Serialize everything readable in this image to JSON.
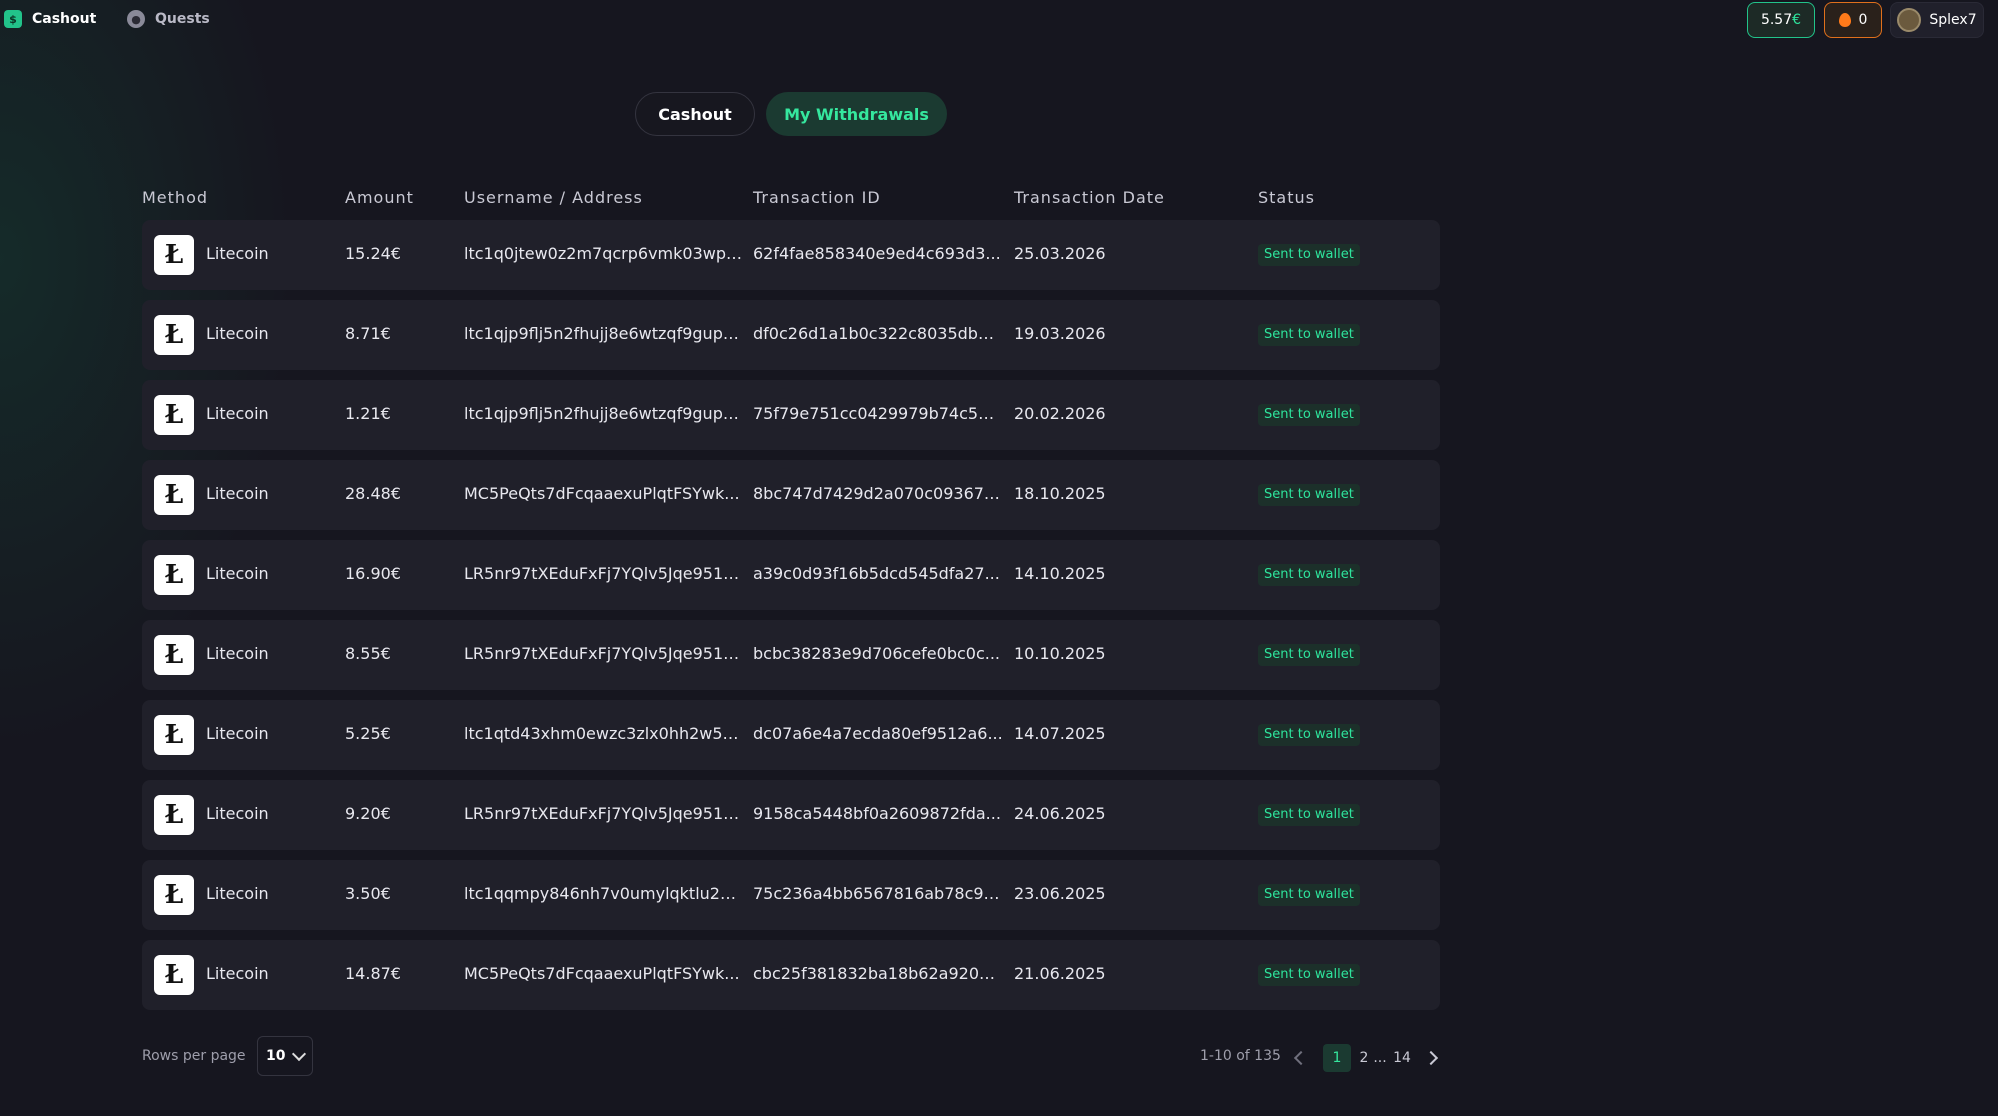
{
  "nav": {
    "items": [
      {
        "label": "Cashout",
        "icon": "dollar-icon"
      },
      {
        "label": "Quests",
        "icon": "medal-icon"
      }
    ],
    "balance": {
      "amount": "5.57",
      "currency": "€"
    },
    "streak": "0",
    "username": "Splex7"
  },
  "tabs": [
    {
      "label": "Cashout",
      "active": false
    },
    {
      "label": "My Withdrawals",
      "active": true
    }
  ],
  "table": {
    "columns": [
      "Method",
      "Amount",
      "Username / Address",
      "Transaction ID",
      "Transaction Date",
      "Status"
    ],
    "rows": [
      {
        "method": "Litecoin",
        "amount": "15.24€",
        "address": "ltc1q0jtew0z2m7qcrp6vmk03wp2...",
        "tx": "62f4fae858340e9ed4c693d3...",
        "date": "25.03.2026",
        "status": "Sent to wallet"
      },
      {
        "method": "Litecoin",
        "amount": "8.71€",
        "address": "ltc1qjp9flj5n2fhujj8e6wtzqf9gup4...",
        "tx": "df0c26d1a1b0c322c8035db0...",
        "date": "19.03.2026",
        "status": "Sent to wallet"
      },
      {
        "method": "Litecoin",
        "amount": "1.21€",
        "address": "ltc1qjp9flj5n2fhujj8e6wtzqf9gup4...",
        "tx": "75f79e751cc0429979b74c534...",
        "date": "20.02.2026",
        "status": "Sent to wallet"
      },
      {
        "method": "Litecoin",
        "amount": "28.48€",
        "address": "MC5PeQts7dFcqaaexuPlqtFSYwk...",
        "tx": "8bc747d7429d2a070c093677...",
        "date": "18.10.2025",
        "status": "Sent to wallet"
      },
      {
        "method": "Litecoin",
        "amount": "16.90€",
        "address": "LR5nr97tXEduFxFj7YQlv5Jqe951Qi...",
        "tx": "a39c0d93f16b5dcd545dfa27...",
        "date": "14.10.2025",
        "status": "Sent to wallet"
      },
      {
        "method": "Litecoin",
        "amount": "8.55€",
        "address": "LR5nr97tXEduFxFj7YQlv5Jqe951Qi...",
        "tx": "bcbc38283e9d706cefe0bc0c...",
        "date": "10.10.2025",
        "status": "Sent to wallet"
      },
      {
        "method": "Litecoin",
        "amount": "5.25€",
        "address": "ltc1qtd43xhm0ewzc3zlx0hh2w53...",
        "tx": "dc07a6e4a7ecda80ef9512a6...",
        "date": "14.07.2025",
        "status": "Sent to wallet"
      },
      {
        "method": "Litecoin",
        "amount": "9.20€",
        "address": "LR5nr97tXEduFxFj7YQlv5Jqe951Qi...",
        "tx": "9158ca5448bf0a2609872fda...",
        "date": "24.06.2025",
        "status": "Sent to wallet"
      },
      {
        "method": "Litecoin",
        "amount": "3.50€",
        "address": "ltc1qqmpy846nh7v0umylqktlu2g...",
        "tx": "75c236a4bb6567816ab78c90...",
        "date": "23.06.2025",
        "status": "Sent to wallet"
      },
      {
        "method": "Litecoin",
        "amount": "14.87€",
        "address": "MC5PeQts7dFcqaaexuPlqtFSYwk...",
        "tx": "cbc25f381832ba18b62a9205d...",
        "date": "21.06.2025",
        "status": "Sent to wallet"
      }
    ]
  },
  "footer": {
    "rows_per_page_label": "Rows per page",
    "rows_per_page_value": "10",
    "range": "1-10 of 135",
    "pages": [
      "1",
      "2",
      "...",
      "14"
    ],
    "current_page": "1"
  },
  "colors": {
    "accent": "#2ee59d",
    "background": "#16161f",
    "row": "#20202a",
    "streak": "#e0701c"
  }
}
